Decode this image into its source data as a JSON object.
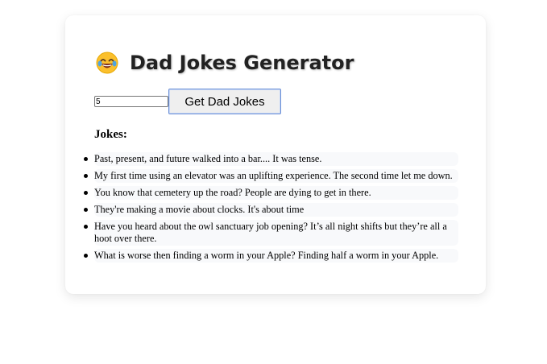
{
  "app": {
    "title": "Dad Jokes Generator",
    "icon": "laughing-face-emoji"
  },
  "controls": {
    "count_value": "5",
    "button_label": "Get Dad Jokes"
  },
  "jokes": {
    "heading": "Jokes:",
    "items": [
      "Past, present, and future walked into a bar.... It was tense.",
      "My first time using an elevator was an uplifting experience. The second time let me down.",
      "You know that cemetery up the road? People are dying to get in there.",
      "They're making a movie about clocks. It's about time",
      "Have you heard about the owl sanctuary job opening? It’s all night shifts but they’re all a hoot over there.",
      "What is worse then finding a worm in your Apple? Finding half a worm in your Apple."
    ]
  }
}
